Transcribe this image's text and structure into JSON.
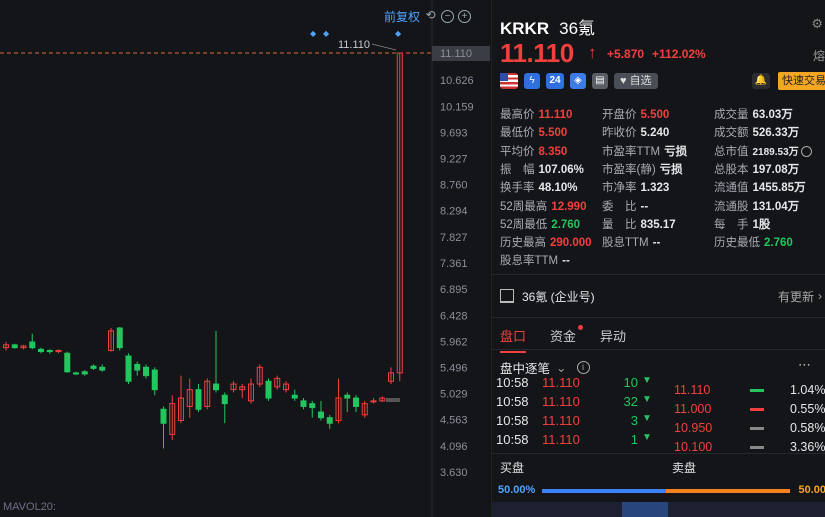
{
  "chart": {
    "toolbar_label": "前复权",
    "price_axis": [
      "11.110",
      "10.626",
      "10.159",
      "9.693",
      "9.227",
      "8.760",
      "8.294",
      "7.827",
      "7.361",
      "6.895",
      "6.428",
      "5.962",
      "5.496",
      "5.029",
      "4.563",
      "4.096",
      "3.630"
    ],
    "marker_label": "11.110",
    "mavol_label": "MAVOL20:",
    "colors": {
      "up": "#f0413e",
      "down": "#22c55e",
      "dash": "#e0693a"
    }
  },
  "chart_data": {
    "type": "candlestick",
    "ylim": [
      3.63,
      11.11
    ],
    "candles": [
      {
        "o": 5.85,
        "c": 5.9,
        "h": 5.95,
        "l": 5.8
      },
      {
        "o": 5.9,
        "c": 5.85,
        "h": 5.92,
        "l": 5.83
      },
      {
        "o": 5.85,
        "c": 5.88,
        "h": 5.9,
        "l": 5.82
      },
      {
        "o": 5.95,
        "c": 5.85,
        "h": 6.1,
        "l": 5.82
      },
      {
        "o": 5.82,
        "c": 5.78,
        "h": 5.85,
        "l": 5.75
      },
      {
        "o": 5.8,
        "c": 5.78,
        "h": 5.82,
        "l": 5.74
      },
      {
        "o": 5.78,
        "c": 5.8,
        "h": 5.82,
        "l": 5.75
      },
      {
        "o": 5.75,
        "c": 5.42,
        "h": 5.78,
        "l": 5.4
      },
      {
        "o": 5.4,
        "c": 5.38,
        "h": 5.42,
        "l": 5.36
      },
      {
        "o": 5.42,
        "c": 5.38,
        "h": 5.45,
        "l": 5.35
      },
      {
        "o": 5.52,
        "c": 5.48,
        "h": 5.55,
        "l": 5.45
      },
      {
        "o": 5.5,
        "c": 5.45,
        "h": 5.55,
        "l": 5.42
      },
      {
        "o": 5.8,
        "c": 6.15,
        "h": 6.2,
        "l": 5.78
      },
      {
        "o": 6.2,
        "c": 5.85,
        "h": 6.22,
        "l": 5.8
      },
      {
        "o": 5.7,
        "c": 5.25,
        "h": 5.75,
        "l": 5.2
      },
      {
        "o": 5.55,
        "c": 5.45,
        "h": 5.6,
        "l": 5.35
      },
      {
        "o": 5.5,
        "c": 5.35,
        "h": 5.55,
        "l": 5.3
      },
      {
        "o": 5.45,
        "c": 5.1,
        "h": 5.5,
        "l": 5.0
      },
      {
        "o": 4.75,
        "c": 4.5,
        "h": 4.8,
        "l": 4.05
      },
      {
        "o": 4.3,
        "c": 4.85,
        "h": 5.0,
        "l": 4.2
      },
      {
        "o": 4.55,
        "c": 4.95,
        "h": 5.35,
        "l": 4.5
      },
      {
        "o": 4.8,
        "c": 5.1,
        "h": 5.3,
        "l": 4.6
      },
      {
        "o": 5.1,
        "c": 4.75,
        "h": 5.2,
        "l": 4.7
      },
      {
        "o": 4.8,
        "c": 5.25,
        "h": 5.3,
        "l": 4.75
      },
      {
        "o": 5.2,
        "c": 5.1,
        "h": 6.15,
        "l": 5.05
      },
      {
        "o": 5.0,
        "c": 4.85,
        "h": 5.05,
        "l": 4.5
      },
      {
        "o": 5.1,
        "c": 5.2,
        "h": 5.25,
        "l": 5.05
      },
      {
        "o": 5.1,
        "c": 5.15,
        "h": 5.2,
        "l": 4.95
      },
      {
        "o": 4.9,
        "c": 5.2,
        "h": 5.3,
        "l": 4.85
      },
      {
        "o": 5.2,
        "c": 5.5,
        "h": 5.55,
        "l": 5.15
      },
      {
        "o": 5.25,
        "c": 4.95,
        "h": 5.3,
        "l": 4.9
      },
      {
        "o": 5.15,
        "c": 5.3,
        "h": 5.35,
        "l": 5.1
      },
      {
        "o": 5.1,
        "c": 5.2,
        "h": 5.25,
        "l": 5.05
      },
      {
        "o": 5.0,
        "c": 4.95,
        "h": 5.1,
        "l": 4.9
      },
      {
        "o": 4.9,
        "c": 4.8,
        "h": 4.95,
        "l": 4.75
      },
      {
        "o": 4.85,
        "c": 4.78,
        "h": 4.9,
        "l": 4.6
      },
      {
        "o": 4.7,
        "c": 4.6,
        "h": 4.9,
        "l": 4.55
      },
      {
        "o": 4.6,
        "c": 4.5,
        "h": 4.65,
        "l": 4.4
      },
      {
        "o": 4.55,
        "c": 4.95,
        "h": 5.3,
        "l": 4.5
      },
      {
        "o": 5.0,
        "c": 4.95,
        "h": 5.05,
        "l": 4.7
      },
      {
        "o": 4.95,
        "c": 4.8,
        "h": 5.0,
        "l": 4.7
      },
      {
        "o": 4.65,
        "c": 4.85,
        "h": 4.9,
        "l": 4.6
      },
      {
        "o": 4.9,
        "c": 4.9,
        "h": 4.95,
        "l": 4.85
      },
      {
        "o": 4.9,
        "c": 4.95,
        "h": 4.98,
        "l": 4.88
      },
      {
        "o": 5.25,
        "c": 5.4,
        "h": 5.5,
        "l": 5.2
      },
      {
        "o": 5.4,
        "c": 11.11,
        "h": 11.11,
        "l": 5.25
      }
    ]
  },
  "quote": {
    "symbol": "KRKR",
    "name_cn": "36氪",
    "price": "11.110",
    "change": "+5.870",
    "change_pct": "+112.02%",
    "cut_label": "熔",
    "badge_24": "24",
    "fav_label": "自选",
    "fast_trade": "快速交易",
    "stats": [
      {
        "label": "最高价",
        "value": "11.110",
        "color": "red"
      },
      {
        "label": "开盘价",
        "value": "5.500",
        "color": "red"
      },
      {
        "label": "成交量",
        "value": "63.03万",
        "color": "white"
      },
      {
        "label": "最低价",
        "value": "5.500",
        "color": "red"
      },
      {
        "label": "昨收价",
        "value": "5.240",
        "color": "white"
      },
      {
        "label": "成交额",
        "value": "526.33万",
        "color": "white"
      },
      {
        "label": "平均价",
        "value": "8.350",
        "color": "red"
      },
      {
        "label": "市盈率TTM",
        "value": "亏损",
        "color": "white"
      },
      {
        "label": "总市值",
        "value": "2189.53万",
        "color": "white"
      },
      {
        "label": "振　幅",
        "value": "107.06%",
        "color": "white"
      },
      {
        "label": "市盈率(静)",
        "value": "亏损",
        "color": "white"
      },
      {
        "label": "总股本",
        "value": "197.08万",
        "color": "white"
      },
      {
        "label": "换手率",
        "value": "48.10%",
        "color": "white"
      },
      {
        "label": "市净率",
        "value": "1.323",
        "color": "white"
      },
      {
        "label": "流通值",
        "value": "1455.85万",
        "color": "white"
      },
      {
        "label": "52周最高",
        "value": "12.990",
        "color": "red"
      },
      {
        "label": "委　比",
        "value": "--",
        "color": "white"
      },
      {
        "label": "流通股",
        "value": "131.04万",
        "color": "white"
      },
      {
        "label": "52周最低",
        "value": "2.760",
        "color": "green"
      },
      {
        "label": "量　比",
        "value": "835.17",
        "color": "white"
      },
      {
        "label": "每　手",
        "value": "1股",
        "color": "white"
      },
      {
        "label": "历史最高",
        "value": "290.000",
        "color": "red"
      },
      {
        "label": "股息TTM",
        "value": "--",
        "color": "white"
      },
      {
        "label": "历史最低",
        "value": "2.760",
        "color": "green"
      },
      {
        "label": "股息率TTM",
        "value": "--",
        "color": "white"
      }
    ],
    "company": {
      "name": "36氪 (企业号)",
      "update": "有更新"
    },
    "tabs": [
      "盘口",
      "资金",
      "异动"
    ],
    "ticker_title": "盘中逐笔",
    "trades": [
      {
        "time": "10:58",
        "price": "11.110",
        "vol": "10"
      },
      {
        "time": "10:58",
        "price": "11.110",
        "vol": "32"
      },
      {
        "time": "10:58",
        "price": "11.110",
        "vol": "3"
      },
      {
        "time": "10:58",
        "price": "11.110",
        "vol": "1"
      }
    ],
    "book": [
      {
        "price": "11.110",
        "pct": "1.04%",
        "bar": "#22c55e"
      },
      {
        "price": "11.000",
        "pct": "0.55%",
        "bar": "#f0413e"
      },
      {
        "price": "10.950",
        "pct": "0.58%",
        "bar": "#888888"
      },
      {
        "price": "10.100",
        "pct": "3.36%",
        "bar": "#888888"
      }
    ],
    "buy_label": "买盘",
    "sell_label": "卖盘",
    "buy_pct": "50.00%",
    "sell_pct": "50.00"
  }
}
